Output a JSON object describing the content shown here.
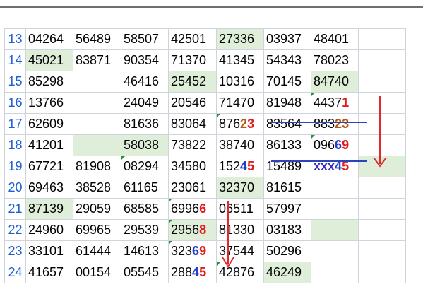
{
  "sheet": {
    "rows": [
      {
        "row": "13",
        "cells": [
          "04264",
          "56489",
          "58507",
          "42501",
          "27336",
          "03937",
          "48401",
          ""
        ]
      },
      {
        "row": "14",
        "cells": [
          "45021",
          "83871",
          "90354",
          "71370",
          "41345",
          "54343",
          "78023",
          ""
        ]
      },
      {
        "row": "15",
        "cells": [
          "85298",
          "",
          "46416",
          "25452",
          "10316",
          "70145",
          "84740",
          ""
        ]
      },
      {
        "row": "16",
        "cells": [
          "13766",
          "",
          "24049",
          "20546",
          "71470",
          "81948",
          "44371",
          ""
        ]
      },
      {
        "row": "17",
        "cells": [
          "62609",
          "",
          "81636",
          "83064",
          "87623",
          "83564",
          "88323",
          ""
        ]
      },
      {
        "row": "18",
        "cells": [
          "41201",
          "",
          "58038",
          "73822",
          "38740",
          "86133",
          "09669",
          ""
        ]
      },
      {
        "row": "19",
        "cells": [
          "67721",
          "81908",
          "08294",
          "34580",
          "15245",
          "15489",
          "xxx45",
          ""
        ]
      },
      {
        "row": "20",
        "cells": [
          "69463",
          "38528",
          "61165",
          "23061",
          "32370",
          "81615",
          "",
          ""
        ]
      },
      {
        "row": "21",
        "cells": [
          "87139",
          "29059",
          "68585",
          "69966",
          "06511",
          "57997",
          "",
          ""
        ]
      },
      {
        "row": "22",
        "cells": [
          "24960",
          "69965",
          "29539",
          "29568",
          "81330",
          "03183",
          "",
          ""
        ]
      },
      {
        "row": "23",
        "cells": [
          "33101",
          "61444",
          "14613",
          "32369",
          "37544",
          "50296",
          "",
          ""
        ]
      },
      {
        "row": "24",
        "cells": [
          "41657",
          "00154",
          "05545",
          "28845",
          "42876",
          "46249",
          "",
          ""
        ]
      }
    ]
  },
  "colors": {
    "row_header": "#1f5fd6",
    "green_fill": "#dfeed8",
    "highlight_red": "#e41b1b",
    "highlight_blue": "#2440c8",
    "highlight_orange": "#b25a14",
    "strike_line": "#2b44b7",
    "arrow": "#e02a2a",
    "comment_marker": "#2a8f3a"
  }
}
